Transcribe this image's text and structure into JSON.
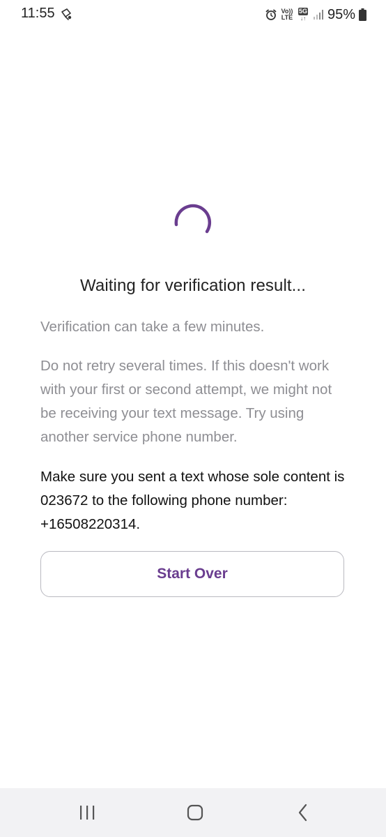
{
  "status_bar": {
    "time": "11:55",
    "volte_line1": "Vo))",
    "volte_line2": "LTE",
    "network": "5G",
    "network_arrows": "↓↑",
    "battery": "95%"
  },
  "main": {
    "title": "Waiting for verification result...",
    "paragraph_1": "Verification can take a few minutes.",
    "paragraph_2": "Do not retry several times. If this doesn't work with your first or second attempt, we might not be receiving your text message. Try using another service phone number.",
    "paragraph_3": "Make sure you sent a text whose sole content is 023672 to the following phone number: +16508220314.",
    "start_over_label": "Start Over"
  },
  "colors": {
    "accent": "#6a3d8f",
    "muted_text": "#8e8e93",
    "nav_background": "#f2f2f4"
  },
  "icons": {
    "status_left": "data-saver-icon",
    "alarm": "alarm-icon",
    "signal": "signal-icon",
    "battery": "battery-icon",
    "recents": "recents-icon",
    "home": "home-icon",
    "back": "back-icon"
  }
}
